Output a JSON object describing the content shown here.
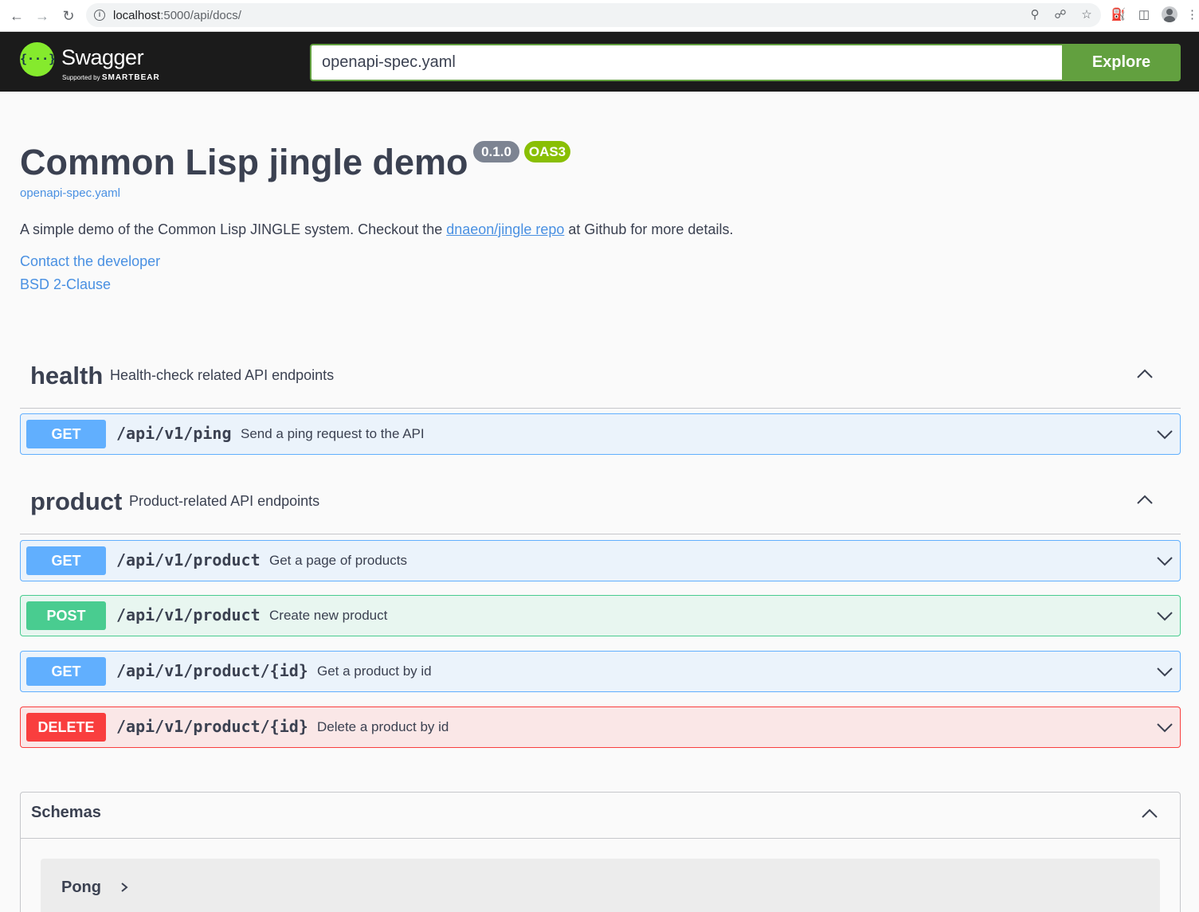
{
  "browser": {
    "url_host": "localhost",
    "url_path": ":5000/api/docs/"
  },
  "topbar": {
    "logo_text": "Swagger",
    "logo_sub_prefix": "Supported by",
    "logo_sub_brand": "SMARTBEAR",
    "spec_value": "openapi-spec.yaml",
    "explore_label": "Explore"
  },
  "info": {
    "title": "Common Lisp jingle demo",
    "version": "0.1.0",
    "oas": "OAS3",
    "spec_link": "openapi-spec.yaml",
    "desc_before": "A simple demo of the Common Lisp JINGLE system. Checkout the ",
    "desc_link": "dnaeon/jingle repo",
    "desc_after": " at Github for more details.",
    "contact": "Contact the developer",
    "license": "BSD 2-Clause"
  },
  "tags": [
    {
      "name": "health",
      "description": "Health-check related API endpoints",
      "operations": [
        {
          "method": "GET",
          "path": "/api/v1/ping",
          "summary": "Send a ping request to the API"
        }
      ]
    },
    {
      "name": "product",
      "description": "Product-related API endpoints",
      "operations": [
        {
          "method": "GET",
          "path": "/api/v1/product",
          "summary": "Get a page of products"
        },
        {
          "method": "POST",
          "path": "/api/v1/product",
          "summary": "Create new product"
        },
        {
          "method": "GET",
          "path": "/api/v1/product/{id}",
          "summary": "Get a product by id"
        },
        {
          "method": "DELETE",
          "path": "/api/v1/product/{id}",
          "summary": "Delete a product by id"
        }
      ]
    }
  ],
  "schemas": {
    "title": "Schemas",
    "models": [
      "Pong"
    ]
  },
  "colors": {
    "get": "#61affe",
    "post": "#49cc90",
    "delete": "#f93e3e",
    "explore": "#62a03f",
    "link": "#4990e2",
    "oas_badge": "#89bf04"
  }
}
